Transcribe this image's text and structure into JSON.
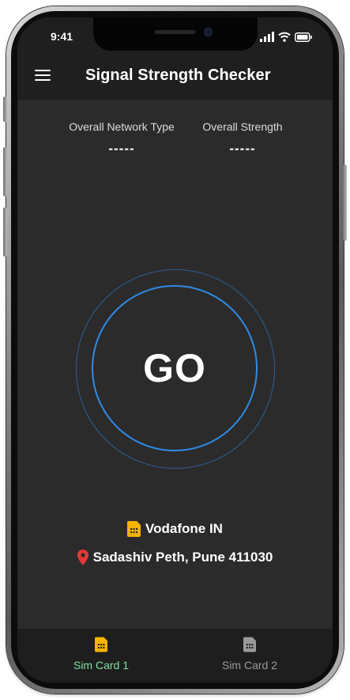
{
  "status_bar": {
    "time": "9:41",
    "signal_icon": "cellular-signal-icon",
    "wifi_icon": "wifi-icon",
    "battery_icon": "battery-icon"
  },
  "app_bar": {
    "menu_icon": "hamburger-menu-icon",
    "title": "Signal Strength Checker"
  },
  "stats": {
    "network_type": {
      "label": "Overall Network Type",
      "value": "-----"
    },
    "strength": {
      "label": "Overall Strength",
      "value": "-----"
    }
  },
  "go_button": {
    "label": "GO"
  },
  "operator": {
    "icon": "sim-card-icon",
    "name": "Vodafone IN"
  },
  "location": {
    "icon": "map-pin-icon",
    "text": "Sadashiv Peth, Pune 411030"
  },
  "bottom_nav": {
    "items": [
      {
        "label": "Sim Card 1",
        "icon": "sim-card-icon",
        "active": true
      },
      {
        "label": "Sim Card 2",
        "icon": "sim-card-icon",
        "active": false
      }
    ]
  },
  "colors": {
    "background": "#2b2b2b",
    "app_bar": "#1f1f1f",
    "ring": "#2f8be6",
    "outer_ring": "#2f5f96",
    "sim_accent": "#f5b400",
    "active_tab": "#7fe0a0",
    "inactive_tab": "#9a9a9a",
    "pin": "#e53935"
  }
}
